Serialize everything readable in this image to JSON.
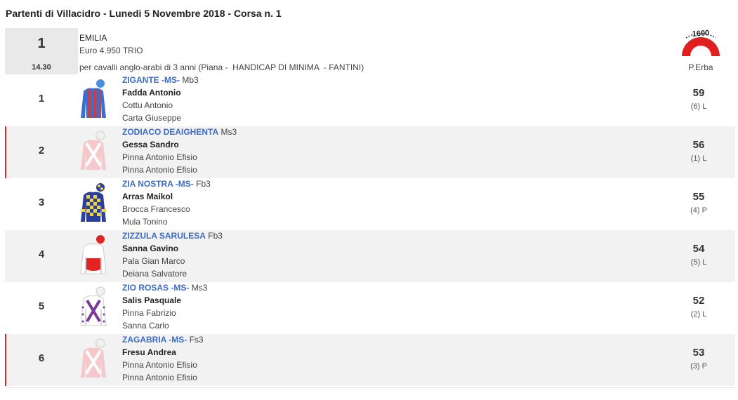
{
  "page": {
    "title": "Partenti di Villacidro - Lunedi 5 Novembre 2018 - Corsa n. 1"
  },
  "race": {
    "number": "1",
    "time": "14.30",
    "name": "EMILIA",
    "prize": "Euro 4.950 TRIO",
    "description": "per cavalli anglo-arabi di 3 anni (Piana -  HANDICAP DI MINIMA  - FANTINI)",
    "distance": "1600",
    "track_type": "P.Erba"
  },
  "colors": {
    "horse_name": "#3b6bc8",
    "flag": "#d62828",
    "track_logo": "#e02020"
  },
  "runners": [
    {
      "number": "1",
      "horse": "ZIGANTE -MS-",
      "class": "Mb3",
      "jockey": "Fadda Antonio",
      "trainer": "Cottu Antonio",
      "owner": "Carta Giuseppe",
      "weight": "59",
      "draw": "(6) L",
      "silk_icon": "blue-red-stripes-silk-icon"
    },
    {
      "number": "2",
      "horse": "ZODIACO DEAIGHENTA",
      "class": "Ms3",
      "jockey": "Gessa Sandro",
      "trainer": "Pinna Antonio Efisio",
      "owner": "Pinna Antonio Efisio",
      "weight": "56",
      "draw": "(1) L",
      "silk_icon": "pink-white-silk-icon"
    },
    {
      "number": "3",
      "horse": "ZIA NOSTRA -MS-",
      "class": "Fb3",
      "jockey": "Arras Maikol",
      "trainer": "Brocca Francesco",
      "owner": "Mula Tonino",
      "weight": "55",
      "draw": "(4) P",
      "silk_icon": "blue-yellow-checks-silk-icon"
    },
    {
      "number": "4",
      "horse": "ZIZZULA SARULESA",
      "class": "Fb3",
      "jockey": "Sanna Gavino",
      "trainer": "Pala Gian Marco",
      "owner": "Deiana Salvatore",
      "weight": "54",
      "draw": "(5) L",
      "silk_icon": "white-red-silk-icon"
    },
    {
      "number": "5",
      "horse": "ZIO ROSAS -MS-",
      "class": "Ms3",
      "jockey": "Salis Pasquale",
      "trainer": "Pinna Fabrizio",
      "owner": "Sanna Carlo",
      "weight": "52",
      "draw": "(2) L",
      "silk_icon": "white-purple-cross-silk-icon"
    },
    {
      "number": "6",
      "horse": "ZAGABRIA -MS-",
      "class": "Fs3",
      "jockey": "Fresu Andrea",
      "trainer": "Pinna Antonio Efisio",
      "owner": "Pinna Antonio Efisio",
      "weight": "53",
      "draw": "(3) P",
      "silk_icon": "pink-white-silk-icon"
    }
  ]
}
